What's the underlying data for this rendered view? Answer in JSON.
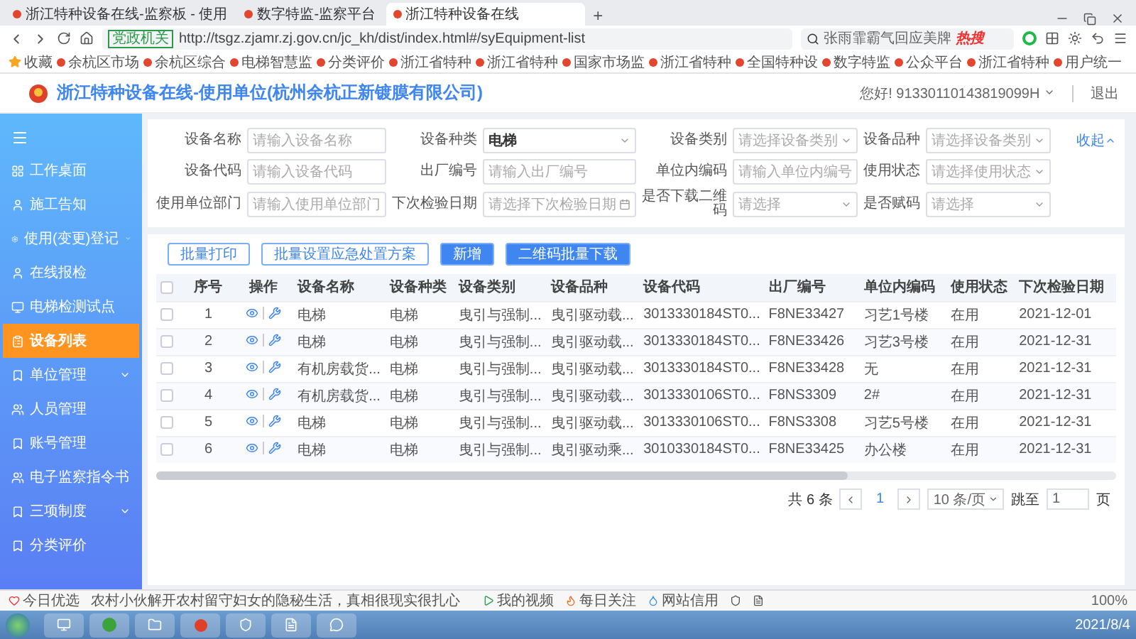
{
  "browser": {
    "tabs": [
      {
        "title": "浙江特种设备在线-监察板 - 使用",
        "selected": false
      },
      {
        "title": "数字特监-监察平台",
        "selected": false
      },
      {
        "title": "浙江特种设备在线",
        "selected": true
      }
    ],
    "new_tab": "+",
    "security_badge": "党政机关",
    "url": "http://tsgz.zjamr.zj.gov.cn/jc_kh/dist/index.html#/syEquipment-list",
    "search": {
      "value": "张雨霏霸气回应美牌",
      "badge": "热搜"
    },
    "bookmarks": [
      {
        "title": "收藏"
      },
      {
        "title": "余杭区市场"
      },
      {
        "title": "余杭区综合"
      },
      {
        "title": "电梯智慧监"
      },
      {
        "title": "分类评价"
      },
      {
        "title": "浙江省特种"
      },
      {
        "title": "浙江省特种"
      },
      {
        "title": "国家市场监"
      },
      {
        "title": "浙江省特种"
      },
      {
        "title": "全国特种设"
      },
      {
        "title": "数字特监"
      },
      {
        "title": "公众平台"
      },
      {
        "title": "浙江省特种"
      },
      {
        "title": "用户统一"
      }
    ]
  },
  "app": {
    "title": "浙江特种设备在线-使用单位(杭州余杭正新镀膜有限公司)",
    "user": "您好! 91330110143819099H",
    "logout": "退出"
  },
  "sidebar": {
    "items": [
      {
        "label": "工作桌面",
        "selected": false,
        "expandable": false
      },
      {
        "label": "施工告知",
        "selected": false,
        "expandable": false
      },
      {
        "label": "使用(变更)登记",
        "selected": false,
        "expandable": true
      },
      {
        "label": "在线报检",
        "selected": false,
        "expandable": false
      },
      {
        "label": "电梯检测试点",
        "selected": false,
        "expandable": false
      },
      {
        "label": "设备列表",
        "selected": true,
        "expandable": false
      },
      {
        "label": "单位管理",
        "selected": false,
        "expandable": true
      },
      {
        "label": "人员管理",
        "selected": false,
        "expandable": false
      },
      {
        "label": "账号管理",
        "selected": false,
        "expandable": false
      },
      {
        "label": "电子监察指令书",
        "selected": false,
        "expandable": false
      },
      {
        "label": "三项制度",
        "selected": false,
        "expandable": true
      },
      {
        "label": "分类评价",
        "selected": false,
        "expandable": false
      }
    ]
  },
  "filters": {
    "fields": [
      {
        "label": "设备名称",
        "kind": "text",
        "placeholder": "请输入设备名称"
      },
      {
        "label": "设备种类",
        "kind": "select",
        "value": "电梯"
      },
      {
        "label": "设备类别",
        "kind": "select",
        "placeholder": "请选择设备类别"
      },
      {
        "label": "设备品种",
        "kind": "select",
        "placeholder": "请选择设备类别"
      },
      {
        "label": "设备代码",
        "kind": "text",
        "placeholder": "请输入设备代码"
      },
      {
        "label": "出厂编号",
        "kind": "text",
        "placeholder": "请输入出厂编号"
      },
      {
        "label": "单位内编码",
        "kind": "text",
        "placeholder": "请输入单位内编号"
      },
      {
        "label": "使用状态",
        "kind": "select",
        "placeholder": "请选择使用状态"
      },
      {
        "label": "使用单位部门",
        "kind": "text",
        "placeholder": "请输入使用单位部门"
      },
      {
        "label": "下次检验日期",
        "kind": "date",
        "placeholder": "请选择下次检验日期"
      },
      {
        "label": "是否下载二维码",
        "kind": "select",
        "placeholder": "请选择"
      },
      {
        "label": "是否赋码",
        "kind": "select",
        "placeholder": "请选择"
      }
    ],
    "collapse": "收起"
  },
  "actions": [
    {
      "label": "批量打印",
      "kind": "outline"
    },
    {
      "label": "批量设置应急处置方案",
      "kind": "outline"
    },
    {
      "label": "新增",
      "kind": "primary"
    },
    {
      "label": "二维码批量下载",
      "kind": "primary"
    }
  ],
  "table": {
    "columns": [
      "序号",
      "操作",
      "设备名称",
      "设备种类",
      "设备类别",
      "设备品种",
      "设备代码",
      "出厂编号",
      "单位内编码",
      "使用状态",
      "下次检验日期"
    ],
    "all_checked": false,
    "rows": [
      {
        "checked": false,
        "cells": [
          "1",
          "",
          "电梯",
          "电梯",
          "曳引与强制...",
          "曳引驱动载...",
          "3013330184ST0...",
          "F8NE33427",
          "习艺1号楼",
          "在用",
          "2021-12-01"
        ]
      },
      {
        "checked": false,
        "cells": [
          "2",
          "",
          "电梯",
          "电梯",
          "曳引与强制...",
          "曳引驱动载...",
          "3013330184ST0...",
          "F8NE33426",
          "习艺3号楼",
          "在用",
          "2021-12-31"
        ]
      },
      {
        "checked": false,
        "cells": [
          "3",
          "",
          "有机房载货...",
          "电梯",
          "曳引与强制...",
          "曳引驱动载...",
          "3013330184ST0...",
          "F8NE33428",
          "无",
          "在用",
          "2021-12-31"
        ]
      },
      {
        "checked": false,
        "cells": [
          "4",
          "",
          "有机房载货...",
          "电梯",
          "曳引与强制...",
          "曳引驱动载...",
          "3013330106ST0...",
          "F8NS3309",
          "2#",
          "在用",
          "2021-12-31"
        ]
      },
      {
        "checked": false,
        "cells": [
          "5",
          "",
          "电梯",
          "电梯",
          "曳引与强制...",
          "曳引驱动载...",
          "3013330106ST0...",
          "F8NS3308",
          "习艺5号楼",
          "在用",
          "2021-12-31"
        ]
      },
      {
        "checked": false,
        "cells": [
          "6",
          "",
          "电梯",
          "电梯",
          "曳引与强制...",
          "曳引驱动乘...",
          "3010330184ST0...",
          "F8NE33425",
          "办公楼",
          "在用",
          "2021-12-31"
        ]
      }
    ]
  },
  "pagination": {
    "total": "共 6 条",
    "pages": [
      {
        "label": "1",
        "selected": true
      }
    ],
    "page_size": "10 条/页",
    "jump_label": "跳至",
    "jump_value": "1",
    "page_suffix": "页"
  },
  "status_bar": {
    "left": "今日优选",
    "news": "农村小伙解开农村留守妇女的隐秘生活，真相很现实很扎心",
    "items": [
      "我的视频",
      "每日关注",
      "网站信用"
    ],
    "zoom": "100%"
  },
  "taskbar": {
    "date": "2021/8/4"
  }
}
